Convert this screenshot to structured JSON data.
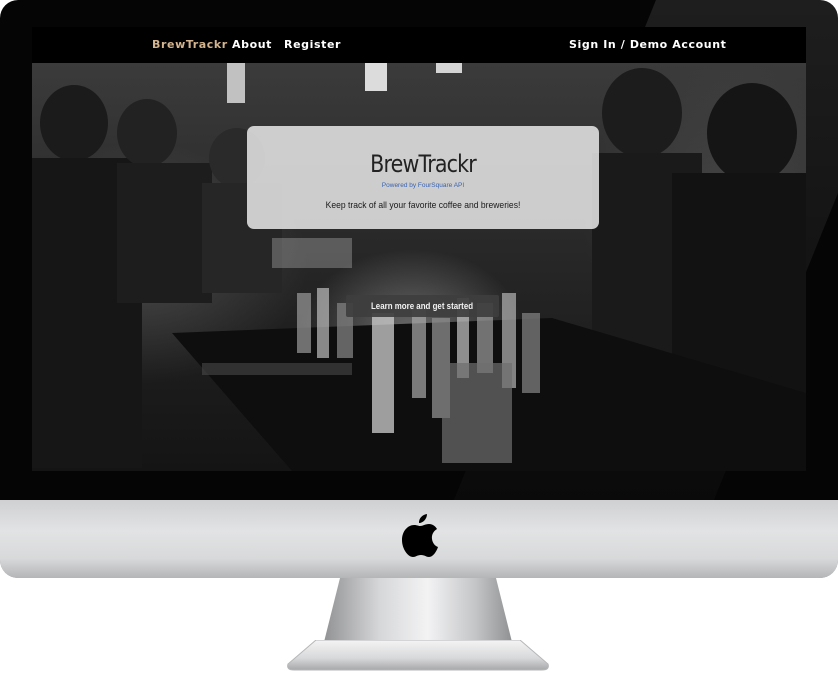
{
  "navbar": {
    "brand": "BrewTrackr",
    "about": "About",
    "register": "Register",
    "signin": "Sign In / Demo Account"
  },
  "hero": {
    "title": "BrewTrackr",
    "powered_by": "Powered by FourSquare API",
    "tagline": "Keep track of all your favorite coffee and breweries!",
    "cta_label": "Learn more and get started"
  },
  "colors": {
    "brand_accent": "#d3b48f",
    "navbar_bg": "#000000",
    "powered_by_link": "#3a63b0",
    "cta_bg": "#3e3e3e"
  },
  "device": {
    "logo_icon": "apple-logo-icon"
  }
}
